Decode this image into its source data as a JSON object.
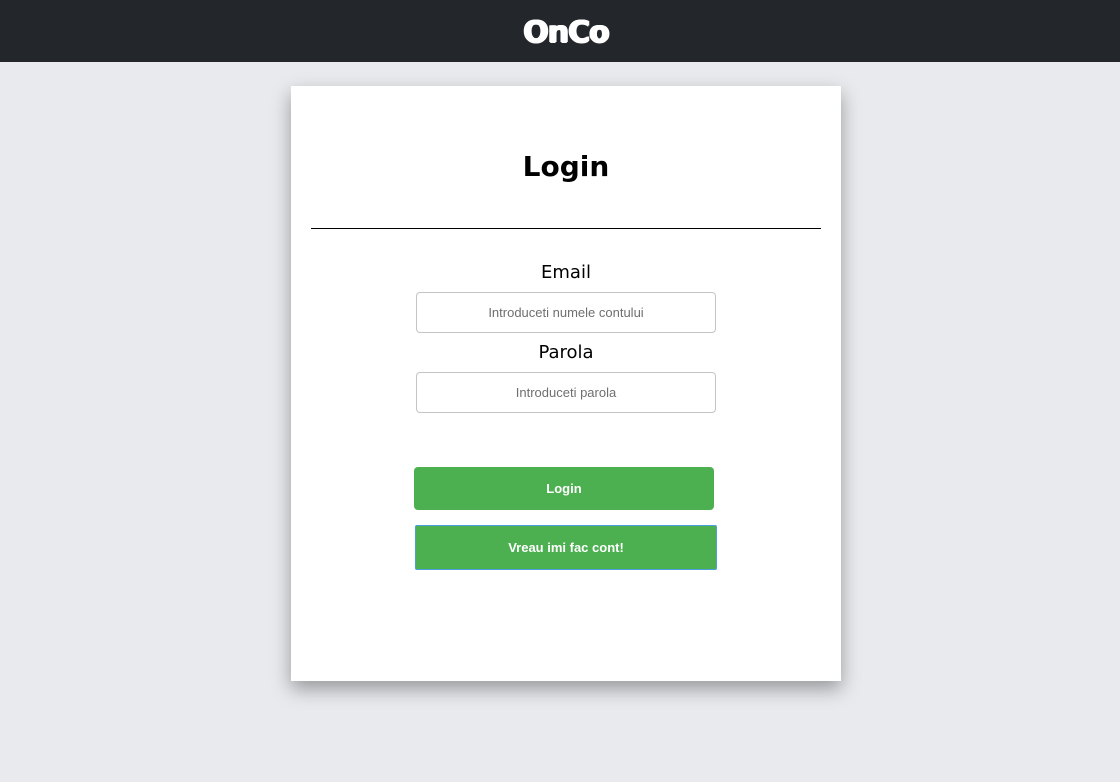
{
  "header": {
    "logo_text": "OnCo",
    "background_color": "#23272b"
  },
  "card": {
    "title": "Login",
    "email": {
      "label": "Email",
      "placeholder": "Introduceti numele contului",
      "value": ""
    },
    "password": {
      "label": "Parola",
      "placeholder": "Introduceti parola",
      "value": ""
    },
    "login_button_label": "Login",
    "register_button_label": "Vreau imi fac cont!"
  },
  "colors": {
    "page_background": "#e9eaee",
    "accent_green": "#4caf50"
  }
}
